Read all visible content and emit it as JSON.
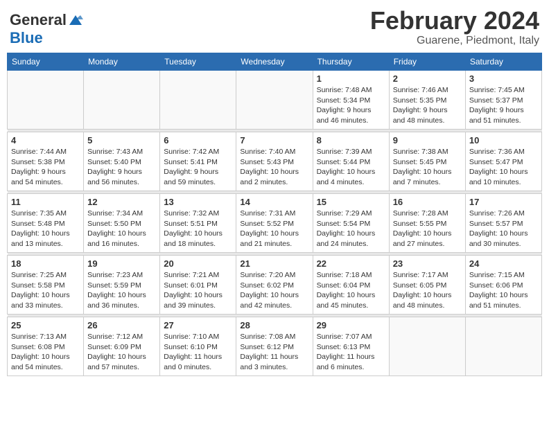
{
  "header": {
    "logo_general": "General",
    "logo_blue": "Blue",
    "month_year": "February 2024",
    "location": "Guarene, Piedmont, Italy"
  },
  "weekdays": [
    "Sunday",
    "Monday",
    "Tuesday",
    "Wednesday",
    "Thursday",
    "Friday",
    "Saturday"
  ],
  "weeks": [
    [
      {
        "day": "",
        "info": ""
      },
      {
        "day": "",
        "info": ""
      },
      {
        "day": "",
        "info": ""
      },
      {
        "day": "",
        "info": ""
      },
      {
        "day": "1",
        "info": "Sunrise: 7:48 AM\nSunset: 5:34 PM\nDaylight: 9 hours\nand 46 minutes."
      },
      {
        "day": "2",
        "info": "Sunrise: 7:46 AM\nSunset: 5:35 PM\nDaylight: 9 hours\nand 48 minutes."
      },
      {
        "day": "3",
        "info": "Sunrise: 7:45 AM\nSunset: 5:37 PM\nDaylight: 9 hours\nand 51 minutes."
      }
    ],
    [
      {
        "day": "4",
        "info": "Sunrise: 7:44 AM\nSunset: 5:38 PM\nDaylight: 9 hours\nand 54 minutes."
      },
      {
        "day": "5",
        "info": "Sunrise: 7:43 AM\nSunset: 5:40 PM\nDaylight: 9 hours\nand 56 minutes."
      },
      {
        "day": "6",
        "info": "Sunrise: 7:42 AM\nSunset: 5:41 PM\nDaylight: 9 hours\nand 59 minutes."
      },
      {
        "day": "7",
        "info": "Sunrise: 7:40 AM\nSunset: 5:43 PM\nDaylight: 10 hours\nand 2 minutes."
      },
      {
        "day": "8",
        "info": "Sunrise: 7:39 AM\nSunset: 5:44 PM\nDaylight: 10 hours\nand 4 minutes."
      },
      {
        "day": "9",
        "info": "Sunrise: 7:38 AM\nSunset: 5:45 PM\nDaylight: 10 hours\nand 7 minutes."
      },
      {
        "day": "10",
        "info": "Sunrise: 7:36 AM\nSunset: 5:47 PM\nDaylight: 10 hours\nand 10 minutes."
      }
    ],
    [
      {
        "day": "11",
        "info": "Sunrise: 7:35 AM\nSunset: 5:48 PM\nDaylight: 10 hours\nand 13 minutes."
      },
      {
        "day": "12",
        "info": "Sunrise: 7:34 AM\nSunset: 5:50 PM\nDaylight: 10 hours\nand 16 minutes."
      },
      {
        "day": "13",
        "info": "Sunrise: 7:32 AM\nSunset: 5:51 PM\nDaylight: 10 hours\nand 18 minutes."
      },
      {
        "day": "14",
        "info": "Sunrise: 7:31 AM\nSunset: 5:52 PM\nDaylight: 10 hours\nand 21 minutes."
      },
      {
        "day": "15",
        "info": "Sunrise: 7:29 AM\nSunset: 5:54 PM\nDaylight: 10 hours\nand 24 minutes."
      },
      {
        "day": "16",
        "info": "Sunrise: 7:28 AM\nSunset: 5:55 PM\nDaylight: 10 hours\nand 27 minutes."
      },
      {
        "day": "17",
        "info": "Sunrise: 7:26 AM\nSunset: 5:57 PM\nDaylight: 10 hours\nand 30 minutes."
      }
    ],
    [
      {
        "day": "18",
        "info": "Sunrise: 7:25 AM\nSunset: 5:58 PM\nDaylight: 10 hours\nand 33 minutes."
      },
      {
        "day": "19",
        "info": "Sunrise: 7:23 AM\nSunset: 5:59 PM\nDaylight: 10 hours\nand 36 minutes."
      },
      {
        "day": "20",
        "info": "Sunrise: 7:21 AM\nSunset: 6:01 PM\nDaylight: 10 hours\nand 39 minutes."
      },
      {
        "day": "21",
        "info": "Sunrise: 7:20 AM\nSunset: 6:02 PM\nDaylight: 10 hours\nand 42 minutes."
      },
      {
        "day": "22",
        "info": "Sunrise: 7:18 AM\nSunset: 6:04 PM\nDaylight: 10 hours\nand 45 minutes."
      },
      {
        "day": "23",
        "info": "Sunrise: 7:17 AM\nSunset: 6:05 PM\nDaylight: 10 hours\nand 48 minutes."
      },
      {
        "day": "24",
        "info": "Sunrise: 7:15 AM\nSunset: 6:06 PM\nDaylight: 10 hours\nand 51 minutes."
      }
    ],
    [
      {
        "day": "25",
        "info": "Sunrise: 7:13 AM\nSunset: 6:08 PM\nDaylight: 10 hours\nand 54 minutes."
      },
      {
        "day": "26",
        "info": "Sunrise: 7:12 AM\nSunset: 6:09 PM\nDaylight: 10 hours\nand 57 minutes."
      },
      {
        "day": "27",
        "info": "Sunrise: 7:10 AM\nSunset: 6:10 PM\nDaylight: 11 hours\nand 0 minutes."
      },
      {
        "day": "28",
        "info": "Sunrise: 7:08 AM\nSunset: 6:12 PM\nDaylight: 11 hours\nand 3 minutes."
      },
      {
        "day": "29",
        "info": "Sunrise: 7:07 AM\nSunset: 6:13 PM\nDaylight: 11 hours\nand 6 minutes."
      },
      {
        "day": "",
        "info": ""
      },
      {
        "day": "",
        "info": ""
      }
    ]
  ]
}
